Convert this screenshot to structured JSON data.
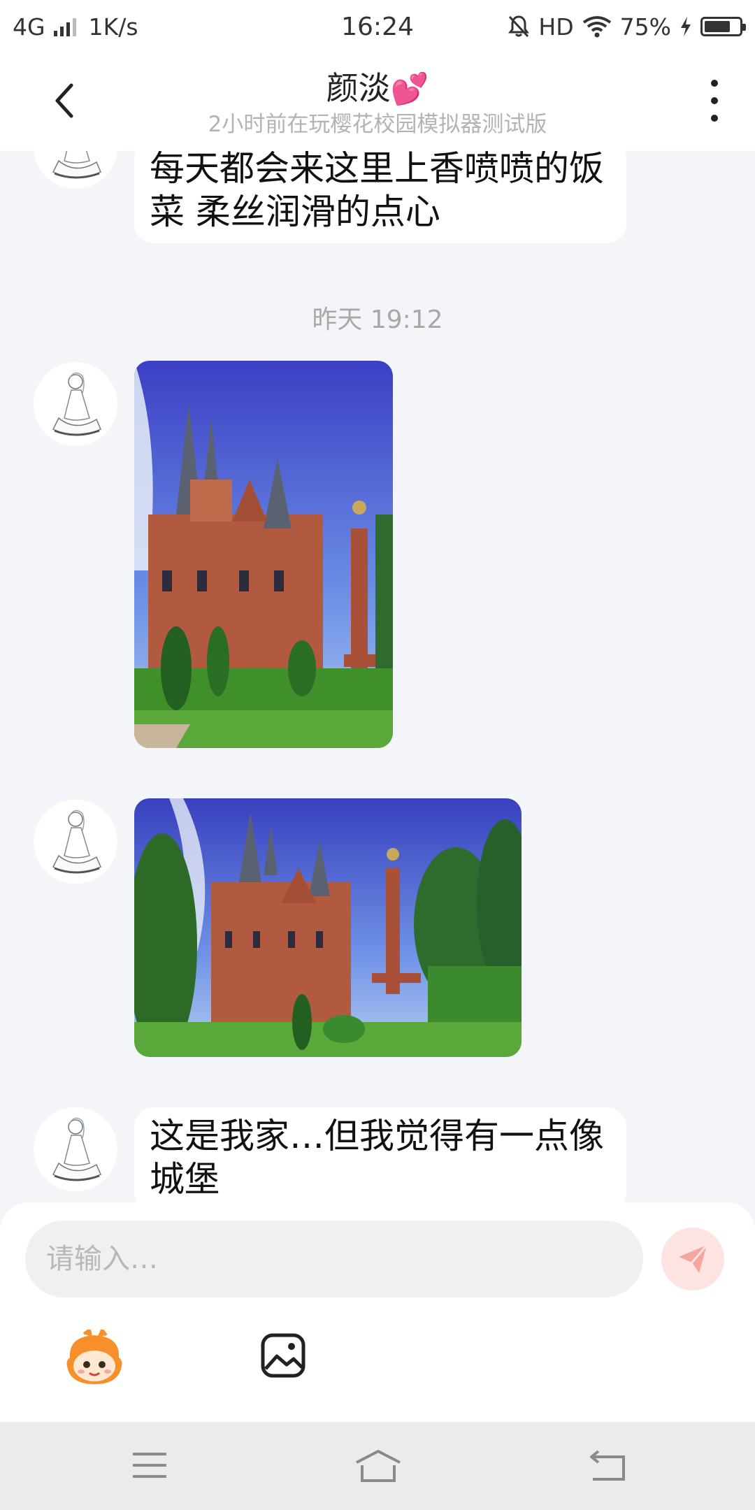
{
  "status_bar": {
    "network": "4G",
    "speed": "1K/s",
    "time": "16:24",
    "hd_label": "HD",
    "battery": "75%",
    "battery_level": 0.75,
    "icons": [
      "signal-icon",
      "mute-bell-icon",
      "wifi-icon",
      "charging-icon",
      "battery-icon"
    ]
  },
  "header": {
    "title": "颜淡",
    "title_emoji": "💕",
    "subtitle": "2小时前在玩樱花校园模拟器测试版",
    "icons": [
      "back-arrow-icon",
      "more-vertical-icon"
    ]
  },
  "messages": [
    {
      "type": "text",
      "text": "每天都会来这里上香喷喷的饭菜  柔丝润滑的点心"
    },
    {
      "type": "timestamp",
      "text": "昨天 19:12"
    },
    {
      "type": "image",
      "content": "castle-photo-portrait"
    },
    {
      "type": "image",
      "content": "castle-photo-landscape"
    },
    {
      "type": "text",
      "text": "这是我家…但我觉得有一点像城堡"
    }
  ],
  "input": {
    "placeholder": "请输入…",
    "value": ""
  },
  "toolbar": {
    "icons": [
      "mascot-sticker-icon",
      "image-picker-icon",
      "send-plane-icon"
    ]
  },
  "nav_bar": {
    "icons": [
      "menu-icon",
      "home-icon",
      "back-icon"
    ]
  },
  "colors": {
    "background": "#f4f5f8",
    "send_button": "#fde3e1",
    "send_icon": "#f7a5a0",
    "heart": "#e8364f",
    "mascot_orange": "#f7902b"
  }
}
